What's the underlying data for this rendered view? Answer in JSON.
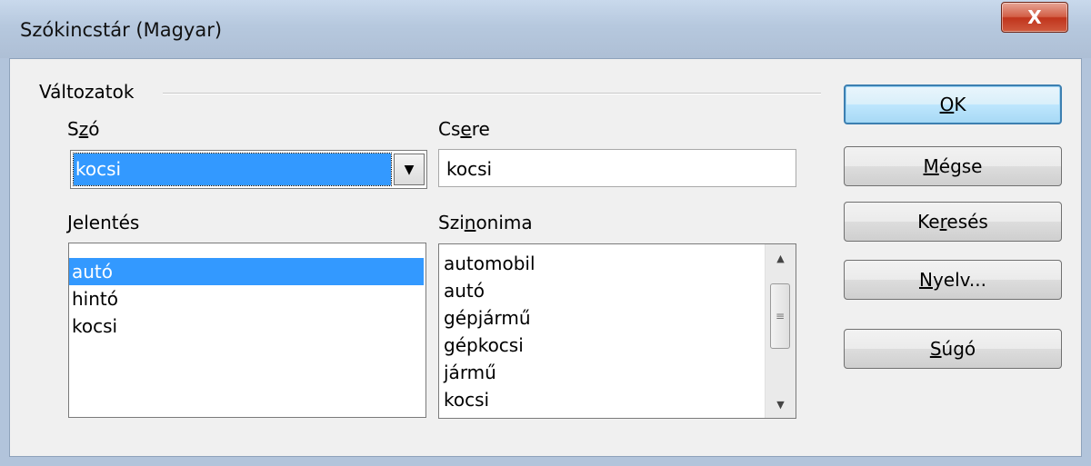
{
  "window": {
    "title": "Szókincstár (Magyar)",
    "close_glyph": "X"
  },
  "group": {
    "label": "Változatok"
  },
  "word": {
    "label_pre": "S",
    "label_key": "z",
    "label_post": "ó",
    "value": "kocsi",
    "arrow_glyph": "▼"
  },
  "replace": {
    "label_pre": "Cs",
    "label_key": "e",
    "label_post": "re",
    "value": "kocsi"
  },
  "meaning": {
    "label_pre": "",
    "label_key": "J",
    "label_post": "elentés",
    "items": [
      "autó",
      "hintó",
      "kocsi"
    ],
    "selected_index": 0
  },
  "synonym": {
    "label_pre": "Szi",
    "label_key": "n",
    "label_post": "onima",
    "items": [
      "automobil",
      "autó",
      "gépjármű",
      "gépkocsi",
      "jármű",
      "kocsi"
    ]
  },
  "scrollbar": {
    "up_glyph": "▲",
    "down_glyph": "▼",
    "grip_glyph": "≡"
  },
  "buttons": {
    "ok": {
      "pre": "",
      "key": "O",
      "post": "K"
    },
    "cancel": {
      "pre": "",
      "key": "M",
      "post": "égse"
    },
    "search": {
      "pre": "Ke",
      "key": "r",
      "post": "esés"
    },
    "language": {
      "pre": "",
      "key": "N",
      "post": "yelv..."
    },
    "help": {
      "pre": "",
      "key": "S",
      "post": "úgó"
    }
  }
}
